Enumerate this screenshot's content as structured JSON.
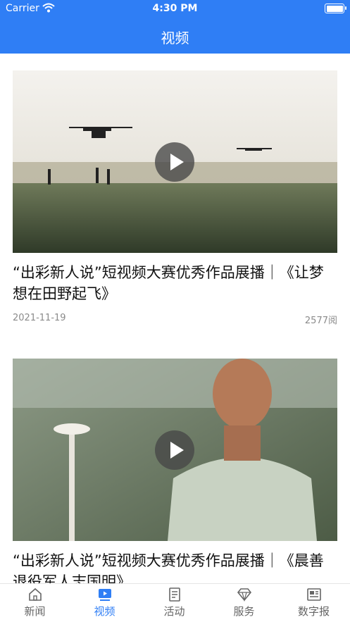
{
  "status_bar": {
    "carrier": "Carrier",
    "time": "4:30 PM"
  },
  "nav": {
    "title": "视频"
  },
  "feed": [
    {
      "title": "“出彩新人说”短视频大赛优秀作品展播｜《让梦想在田野起飞》",
      "date": "2021-11-19",
      "views": "2577阅"
    },
    {
      "title": "“出彩新人说”短视频大赛优秀作品展播｜《晨善退役军人志国明》",
      "date": "",
      "views": ""
    }
  ],
  "tabs": [
    {
      "label": "新闻",
      "icon": "home-icon"
    },
    {
      "label": "视频",
      "icon": "video-icon",
      "active": true
    },
    {
      "label": "活动",
      "icon": "document-icon"
    },
    {
      "label": "服务",
      "icon": "diamond-icon"
    },
    {
      "label": "数字报",
      "icon": "newspaper-icon"
    }
  ],
  "colors": {
    "accent": "#2f7ef5",
    "tab_inactive": "#666666",
    "meta_text": "#8a8a8a"
  }
}
